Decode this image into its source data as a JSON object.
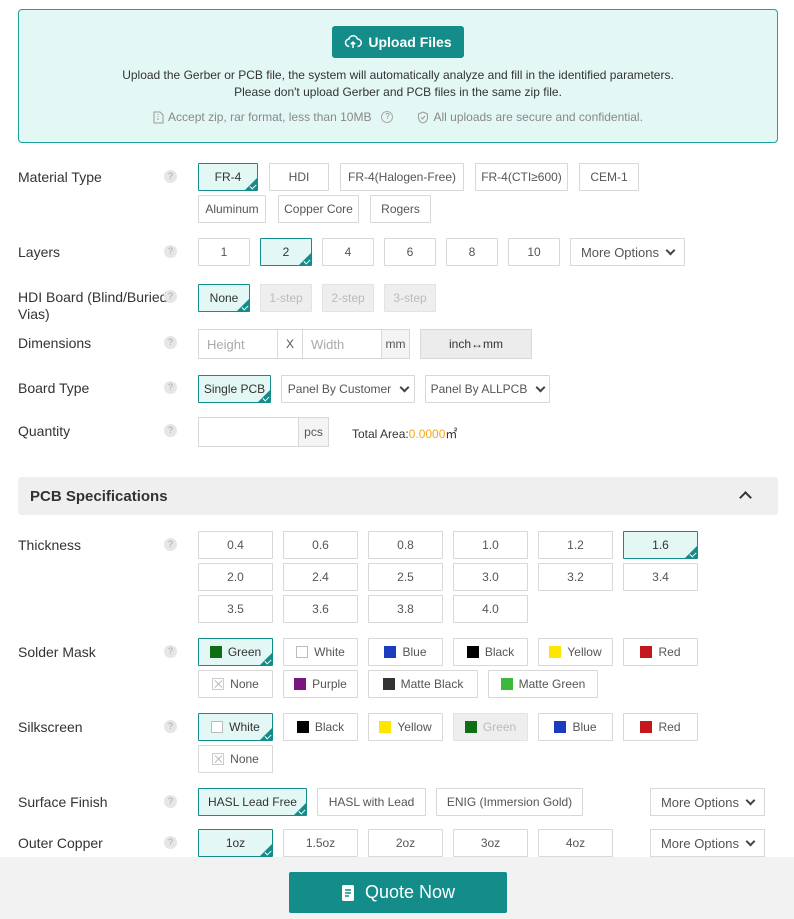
{
  "upload": {
    "button_label": "Upload Files",
    "line1": "Upload the Gerber or PCB file, the system will automatically analyze and fill in the identified parameters.",
    "line2": "Please don't upload Gerber and PCB files in the same zip file.",
    "note1": "Accept zip, rar format, less than 10MB",
    "note2": "All uploads are secure and confidential."
  },
  "help_glyph": "?",
  "material": {
    "label": "Material Type",
    "options": [
      "FR-4",
      "HDI",
      "FR-4(Halogen-Free)",
      "FR-4(CTI≥600)",
      "CEM-1",
      "Aluminum",
      "Copper Core",
      "Rogers"
    ],
    "selected": "FR-4"
  },
  "layers": {
    "label": "Layers",
    "options": [
      "1",
      "2",
      "4",
      "6",
      "8",
      "10"
    ],
    "selected": "2",
    "more": "More Options"
  },
  "hdi": {
    "label": "HDI Board (Blind/Buried Vias)",
    "options": [
      "None",
      "1-step",
      "2-step",
      "3-step"
    ],
    "selected": "None"
  },
  "dimensions": {
    "label": "Dimensions",
    "height_placeholder": "Height",
    "x": "X",
    "width_placeholder": "Width",
    "unit": "mm",
    "convert": "inch↔mm"
  },
  "board_type": {
    "label": "Board Type",
    "options": [
      "Single PCB",
      "Panel By Customer",
      "Panel By ALLPCB"
    ],
    "selected": "Single PCB"
  },
  "quantity": {
    "label": "Quantity",
    "unit": "pcs",
    "total_area_label": "Total Area:",
    "total_area_value": "0.0000",
    "total_area_unit": "㎡"
  },
  "specs": {
    "title": "PCB Specifications"
  },
  "thickness": {
    "label": "Thickness",
    "options": [
      "0.4",
      "0.6",
      "0.8",
      "1.0",
      "1.2",
      "1.6",
      "2.0",
      "2.4",
      "2.5",
      "3.0",
      "3.2",
      "3.4",
      "3.5",
      "3.6",
      "3.8",
      "4.0"
    ],
    "selected": "1.6"
  },
  "solder_mask": {
    "label": "Solder Mask",
    "options": [
      {
        "name": "Green",
        "color": "#0e6e14"
      },
      {
        "name": "White",
        "color": "#ffffff"
      },
      {
        "name": "Blue",
        "color": "#1a3cc0"
      },
      {
        "name": "Black",
        "color": "#000000"
      },
      {
        "name": "Yellow",
        "color": "#ffe600"
      },
      {
        "name": "Red",
        "color": "#c4171c"
      },
      {
        "name": "None",
        "color": "none"
      },
      {
        "name": "Purple",
        "color": "#7a1483"
      },
      {
        "name": "Matte Black",
        "color": "#333333"
      },
      {
        "name": "Matte Green",
        "color": "#3cb83a"
      }
    ],
    "selected": "Green"
  },
  "silkscreen": {
    "label": "Silkscreen",
    "options": [
      {
        "name": "White",
        "color": "#ffffff"
      },
      {
        "name": "Black",
        "color": "#000000"
      },
      {
        "name": "Yellow",
        "color": "#ffe600"
      },
      {
        "name": "Green",
        "color": "#0e6e14"
      },
      {
        "name": "Blue",
        "color": "#1a3cc0"
      },
      {
        "name": "Red",
        "color": "#c4171c"
      },
      {
        "name": "None",
        "color": "none"
      }
    ],
    "selected": "White",
    "disabled": "Green"
  },
  "surface_finish": {
    "label": "Surface Finish",
    "options": [
      "HASL Lead Free",
      "HASL with Lead",
      "ENIG (Immersion Gold)"
    ],
    "selected": "HASL Lead Free",
    "more": "More Options"
  },
  "outer_copper": {
    "label": "Outer Copper",
    "options": [
      "1oz",
      "1.5oz",
      "2oz",
      "3oz",
      "4oz"
    ],
    "selected": "1oz",
    "more": "More Options"
  },
  "quote": {
    "label": "Quote Now"
  },
  "colors": {
    "accent": "#138c8a",
    "area_value": "#f5a623"
  }
}
